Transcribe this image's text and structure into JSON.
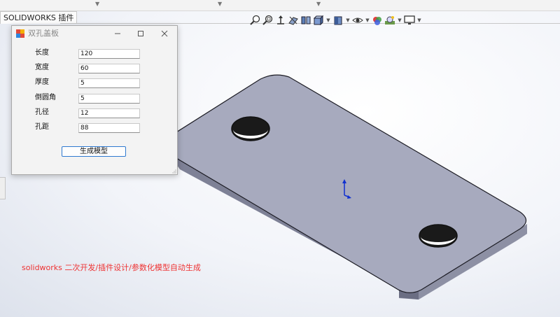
{
  "top_tab": {
    "label": "SOLIDWORKS 插件"
  },
  "toolbar": {
    "icons": [
      "zoom-to-fit-icon",
      "zoom-area-icon",
      "previous-view-icon",
      "section-view-icon",
      "dynamic-annotation-icon",
      "view-orientation-icon",
      "display-style-icon",
      "hide-show-items-icon",
      "edit-appearance-icon",
      "apply-scene-icon",
      "view-settings-icon"
    ]
  },
  "dialog": {
    "title": "双孔盖板",
    "fields": [
      {
        "label": "长度",
        "value": "120"
      },
      {
        "label": "宽度",
        "value": "60"
      },
      {
        "label": "厚度",
        "value": "5"
      },
      {
        "label": "倒圆角",
        "value": "5"
      },
      {
        "label": "孔径",
        "value": "12"
      },
      {
        "label": "孔距",
        "value": "88"
      }
    ],
    "button_label": "生成模型"
  },
  "caption": "solidworks 二次开发/插件设计/参数化模型自动生成",
  "colors": {
    "part_top": "#a7aabe",
    "part_side": "#7e8196",
    "caption": "#ee3333",
    "button_border": "#2f7ad0"
  }
}
